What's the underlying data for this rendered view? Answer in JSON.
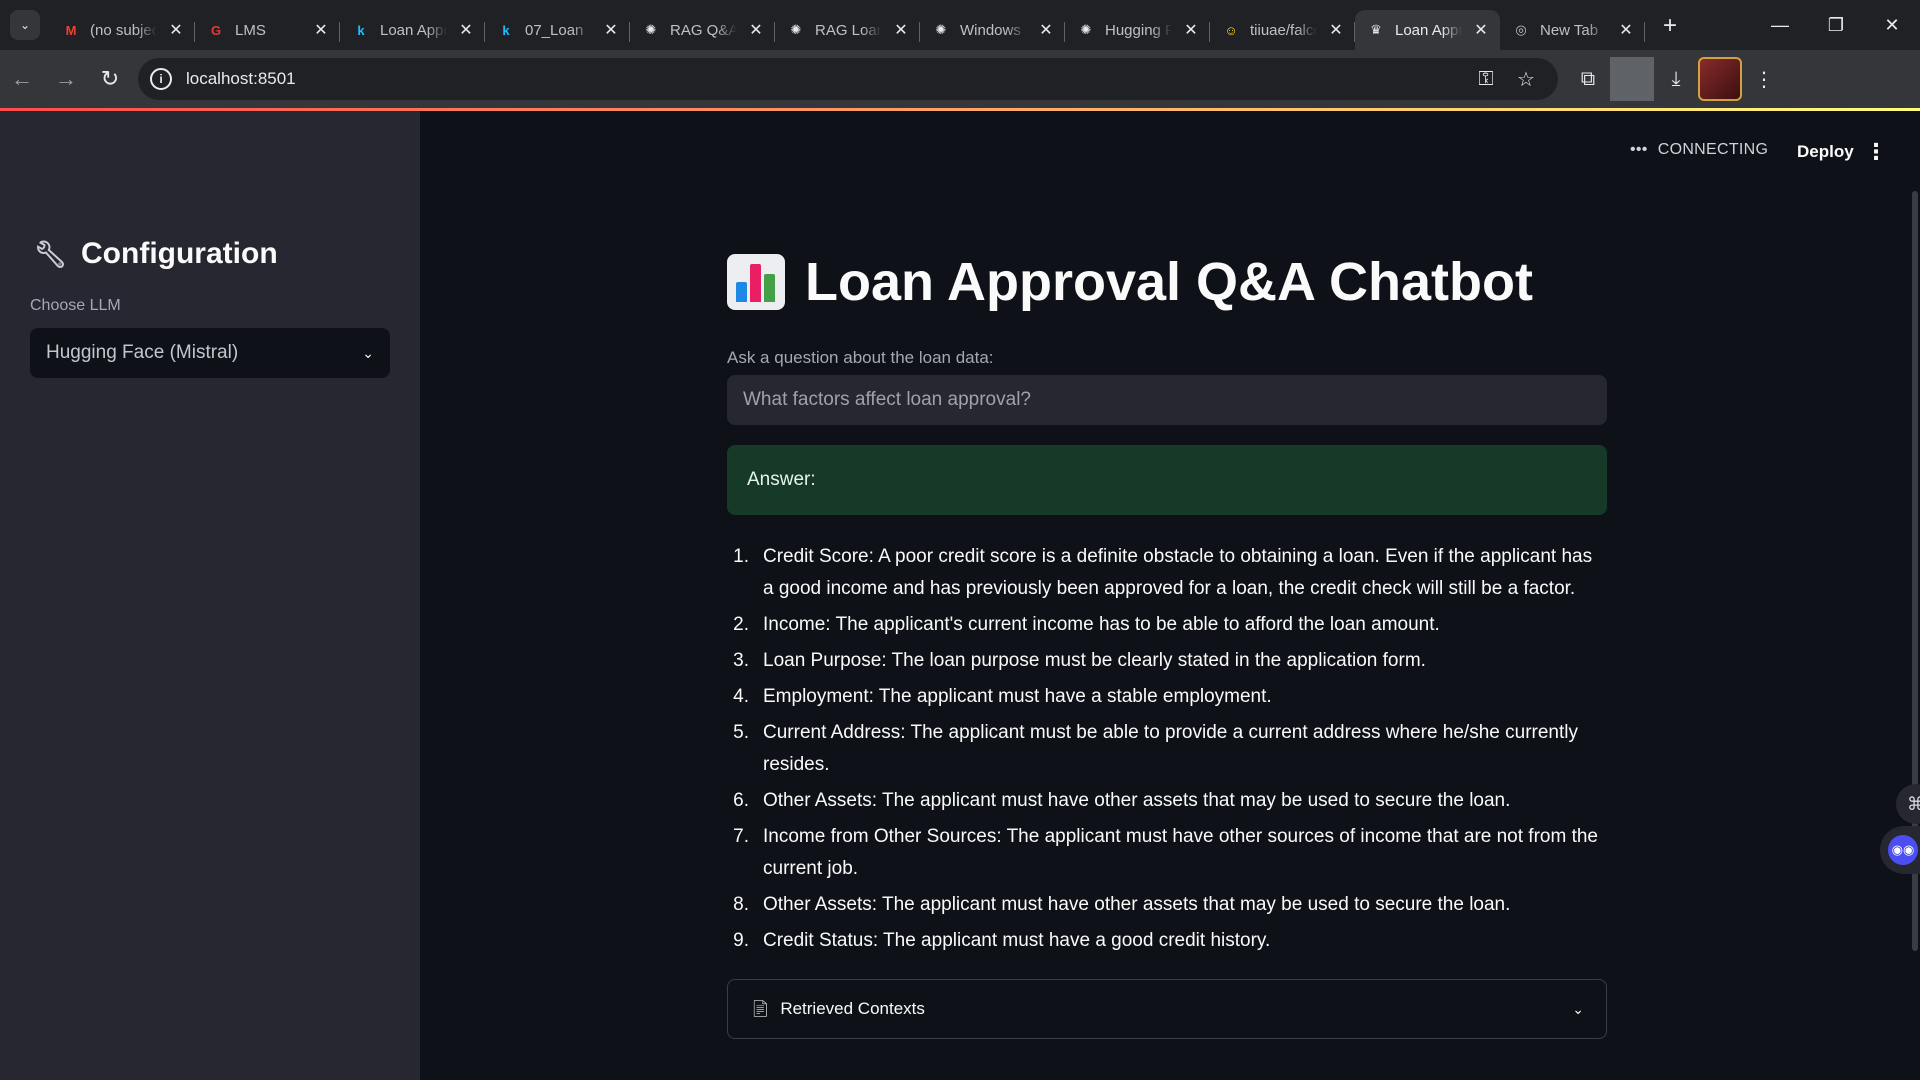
{
  "browser": {
    "tabs": [
      {
        "title": "(no subject)",
        "icon": "gmail-icon",
        "icon_glyph": "M",
        "icon_color": "#ea4335",
        "active": false
      },
      {
        "title": "LMS",
        "icon": "lms-icon",
        "icon_glyph": "G",
        "icon_color": "#e53935",
        "active": false
      },
      {
        "title": "Loan Approval",
        "icon": "kaggle-icon",
        "icon_glyph": "k",
        "icon_color": "#20beff",
        "active": false
      },
      {
        "title": "07_Loan",
        "icon": "kaggle-icon",
        "icon_glyph": "k",
        "icon_color": "#20beff",
        "active": false
      },
      {
        "title": "RAG Q&A",
        "icon": "openai-icon",
        "icon_glyph": "✺",
        "icon_color": "#e8eaed",
        "active": false
      },
      {
        "title": "RAG Loan",
        "icon": "openai-icon",
        "icon_glyph": "✺",
        "icon_color": "#e8eaed",
        "active": false
      },
      {
        "title": "Windows",
        "icon": "openai-icon",
        "icon_glyph": "✺",
        "icon_color": "#e8eaed",
        "active": false
      },
      {
        "title": "Hugging Face",
        "icon": "openai-icon",
        "icon_glyph": "✺",
        "icon_color": "#e8eaed",
        "active": false
      },
      {
        "title": "tiiuae/falcon",
        "icon": "huggingface-icon",
        "icon_glyph": "☺",
        "icon_color": "#ffd21e",
        "active": false
      },
      {
        "title": "Loan Approval",
        "icon": "streamlit-icon",
        "icon_glyph": "♛",
        "icon_color": "#e8eaed",
        "active": true
      },
      {
        "title": "New Tab",
        "icon": "chrome-icon",
        "icon_glyph": "◎",
        "icon_color": "#bdc1c6",
        "active": false
      }
    ],
    "url": "localhost:8501"
  },
  "header": {
    "status": "CONNECTING",
    "deploy_label": "Deploy"
  },
  "sidebar": {
    "title": "Configuration",
    "llm_label": "Choose LLM",
    "llm_selected": "Hugging Face (Mistral)"
  },
  "main": {
    "title": "Loan Approval Q&A Chatbot",
    "question_label": "Ask a question about the loan data:",
    "question_placeholder": "What factors affect loan approval?",
    "answer_heading": "Answer:",
    "answer_items": [
      {
        "num": "1.",
        "text": "Credit Score: A poor credit score is a definite obstacle to obtaining a loan. Even if the applicant has a good income and has previously been approved for a loan, the credit check will still be a factor."
      },
      {
        "num": "2.",
        "text": "Income: The applicant's current income has to be able to afford the loan amount."
      },
      {
        "num": "3.",
        "text": "Loan Purpose: The loan purpose must be clearly stated in the application form."
      },
      {
        "num": "4.",
        "text": "Employment: The applicant must have a stable employment."
      },
      {
        "num": "5.",
        "text": "Current Address: The applicant must be able to provide a current address where he/she currently resides."
      },
      {
        "num": "6.",
        "text": "Other Assets: The applicant must have other assets that may be used to secure the loan."
      },
      {
        "num": "7.",
        "text": "Income from Other Sources: The applicant must have other sources of income that are not from the current job."
      },
      {
        "num": "8.",
        "text": "Other Assets: The applicant must have other assets that may be used to secure the loan."
      },
      {
        "num": "9.",
        "text": "Credit Status: The applicant must have a good credit history."
      }
    ],
    "contexts_label": "Retrieved Contexts"
  },
  "colors": {
    "accent_red": "#ff4b4b",
    "answer_bg": "#173928",
    "sidebar_bg": "#262730",
    "main_bg": "#0e1117"
  }
}
